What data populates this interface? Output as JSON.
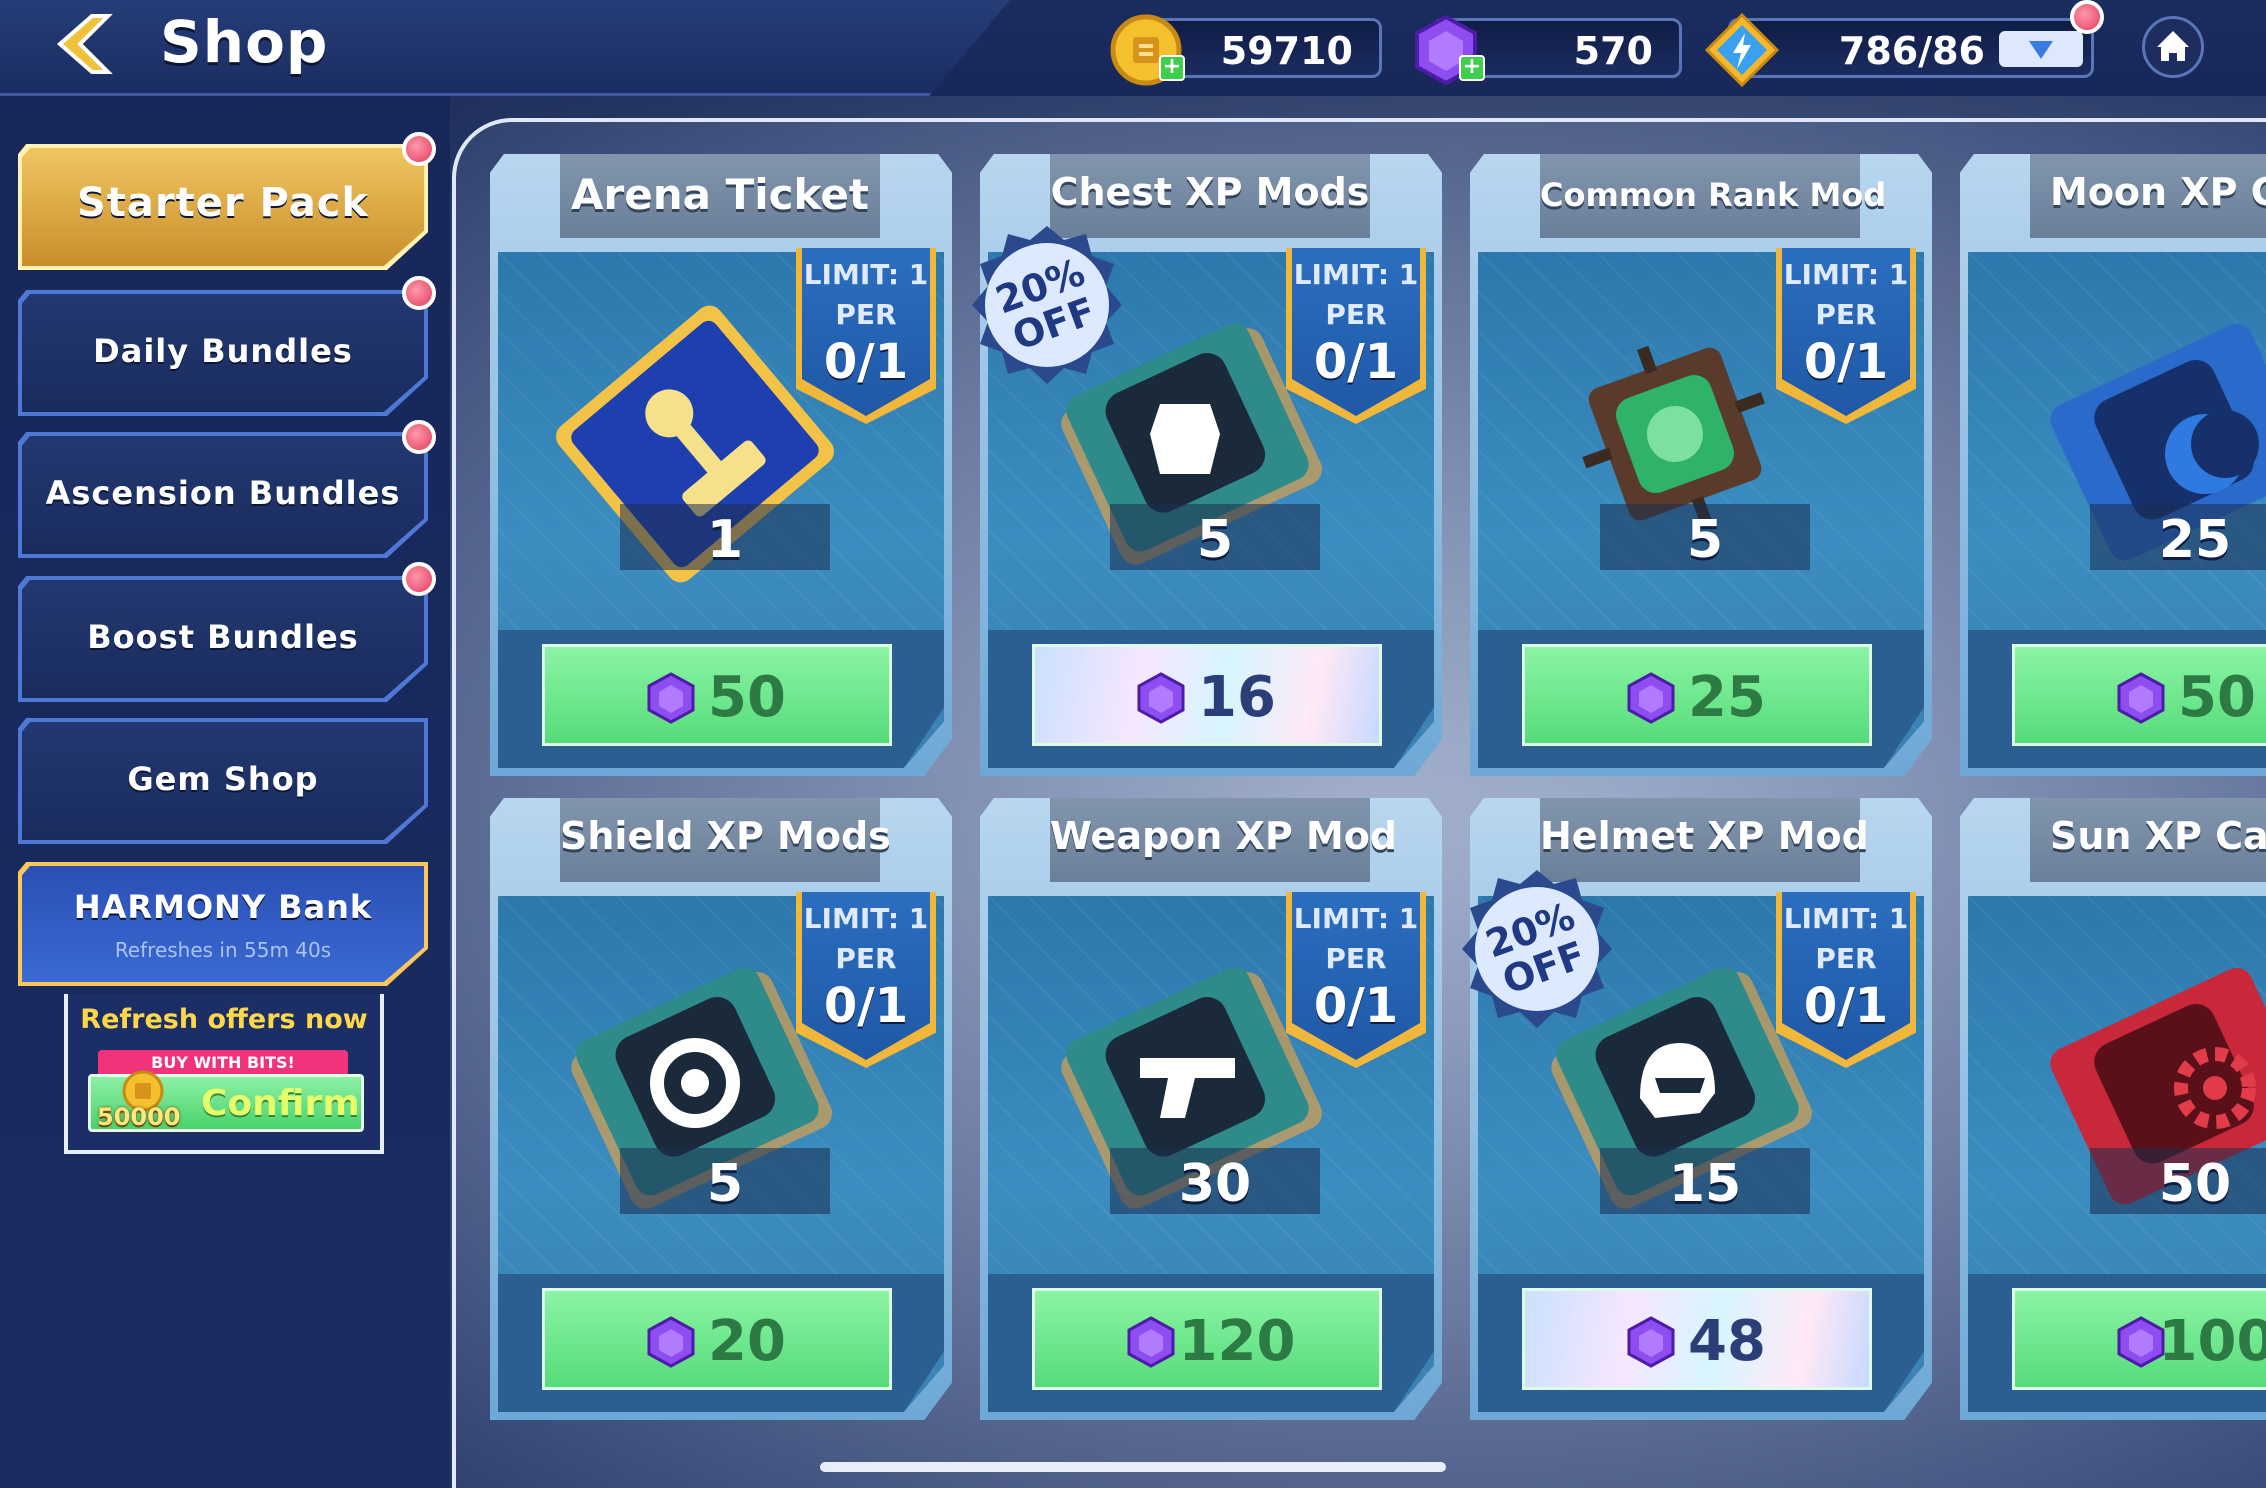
{
  "header": {
    "title": "Shop",
    "coins": "59710",
    "gems": "570",
    "energy": "786/86"
  },
  "sidebar": {
    "items": [
      {
        "label": "Starter Pack"
      },
      {
        "label": "Daily Bundles"
      },
      {
        "label": "Ascension Bundles"
      },
      {
        "label": "Boost Bundles"
      },
      {
        "label": "Gem Shop"
      },
      {
        "label": "HARMONY Bank",
        "sub": "Refreshes in 55m 40s"
      }
    ],
    "refresh": {
      "title": "Refresh offers now",
      "buy_with_bits": "BUY WITH BITS!",
      "cost": "50000",
      "confirm": "Confirm"
    }
  },
  "cards": [
    {
      "title": "Arena Ticket",
      "limit_line1": "LIMIT: 1",
      "limit_line2": "PER",
      "limit_count": "0/1",
      "quantity": "1",
      "price": "50"
    },
    {
      "title": "Chest XP Mods",
      "limit_line1": "LIMIT: 1",
      "limit_line2": "PER",
      "limit_count": "0/1",
      "quantity": "5",
      "price": "16",
      "sale": "20%",
      "sale2": "OFF"
    },
    {
      "title": "Common Rank Mod",
      "limit_line1": "LIMIT: 1",
      "limit_line2": "PER",
      "limit_count": "0/1",
      "quantity": "5",
      "price": "25"
    },
    {
      "title": "Moon XP Ca",
      "quantity": "25",
      "price": "50"
    },
    {
      "title": "Shield XP Mods",
      "limit_line1": "LIMIT: 1",
      "limit_line2": "PER",
      "limit_count": "0/1",
      "quantity": "5",
      "price": "20"
    },
    {
      "title": "Weapon XP Mod",
      "limit_line1": "LIMIT: 1",
      "limit_line2": "PER",
      "limit_count": "0/1",
      "quantity": "30",
      "price": "120"
    },
    {
      "title": "Helmet XP Mod",
      "limit_line1": "LIMIT: 1",
      "limit_line2": "PER",
      "limit_count": "0/1",
      "quantity": "15",
      "price": "48",
      "sale": "20%",
      "sale2": "OFF"
    },
    {
      "title": "Sun XP Ca",
      "quantity": "50",
      "price": "100"
    }
  ],
  "colors": {
    "gold": "#f1b73a",
    "green_button": "#56dc7a",
    "notification": "#e23b5e",
    "gem": "#7b3fd6"
  }
}
